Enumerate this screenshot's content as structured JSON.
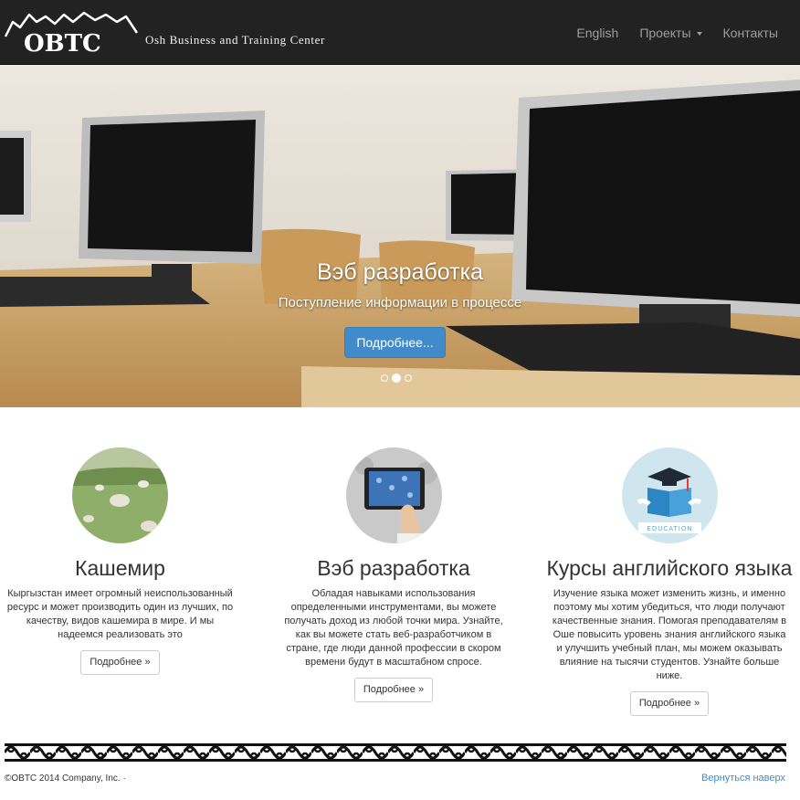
{
  "brand": {
    "logo_text": "OBTC",
    "subtitle": "Osh Business and Training Center"
  },
  "nav": {
    "english": "English",
    "projects": "Проекты",
    "contacts": "Контакты"
  },
  "carousel": {
    "title": "Вэб разработка",
    "text": "Поступление информации в процессе",
    "button": "Подробнее...",
    "slides": 3,
    "active_slide": 2
  },
  "features": [
    {
      "title": "Кашемир",
      "text": "Кыргызстан имеет огромный неиспользованный ресурс и может производить один из лучших, по качеству, видов кашемира в мире. И мы надеемся реализовать это",
      "button": "Подробнее »",
      "image": "sheep-photo"
    },
    {
      "title": "Вэб разработка",
      "text": "Обладая навыками использования определенными инструментами, вы можете получать доход из любой точки мира. Узнайте, как вы можете стать веб-разработчиком в стране, где люди данной профессии в скором времени будут в масштабном спросе.",
      "button": "Подробнее »",
      "image": "tablet-photo"
    },
    {
      "title": "Курсы английского языка",
      "text": "Изучение языка может изменить жизнь, и именно поэтому мы хотим убедиться, что люди получают качественные знания. Помогая преподавателям в Оше повысить уровень знания английского языка и улучшить учебный план, мы можем оказывать влияние на тысячи студентов. Узнайте больше ниже.",
      "button": "Подробнее »",
      "image": "education-icon",
      "image_label": "EDUCATION"
    }
  ],
  "footer": {
    "copyright": "©OBTC 2014 Company, Inc. ·",
    "back_to_top": "Вернуться наверх"
  },
  "colors": {
    "navbar": "#222222",
    "primary": "#428bca",
    "link": "#428bca"
  }
}
